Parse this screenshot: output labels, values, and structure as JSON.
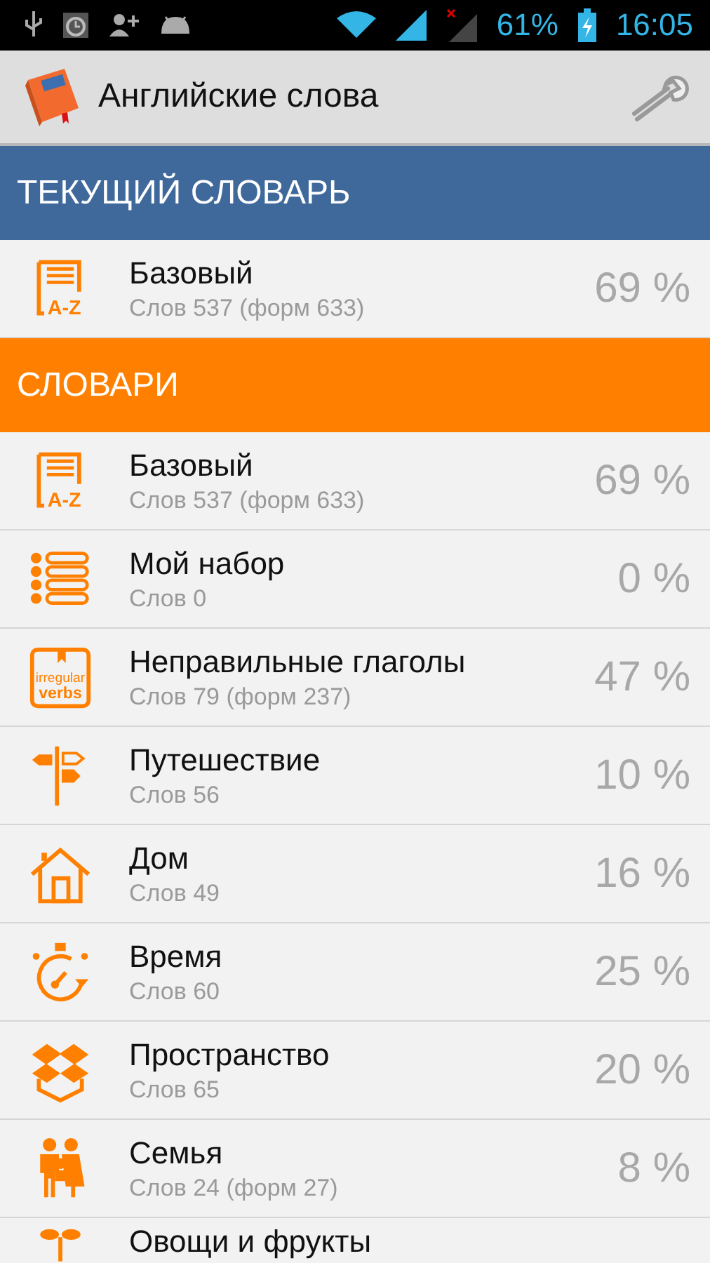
{
  "status_bar": {
    "battery": "61%",
    "time": "16:05"
  },
  "app_bar": {
    "title": "Английские слова"
  },
  "current_section": {
    "title": "ТЕКУЩИЙ СЛОВАРЬ",
    "items": [
      {
        "kind": "az",
        "icon_text": "A-Z",
        "title": "Базовый",
        "subtitle": "Слов 537 (форм 633)",
        "percent": "69 %"
      }
    ]
  },
  "dictionaries_section": {
    "title": "СЛОВАРИ",
    "items": [
      {
        "kind": "az",
        "icon_text": "A-Z",
        "title": "Базовый",
        "subtitle": "Слов 537 (форм 633)",
        "percent": "69 %"
      },
      {
        "kind": "list",
        "title": "Мой набор",
        "subtitle": "Слов 0",
        "percent": "0 %"
      },
      {
        "kind": "verbs",
        "icon_text": "irregular verbs",
        "title": "Неправильные глаголы",
        "subtitle": "Слов 79 (форм 237)",
        "percent": "47 %"
      },
      {
        "kind": "signpost",
        "title": "Путешествие",
        "subtitle": "Слов 56",
        "percent": "10 %"
      },
      {
        "kind": "house",
        "title": "Дом",
        "subtitle": "Слов 49",
        "percent": "16 %"
      },
      {
        "kind": "stopwatch",
        "title": "Время",
        "subtitle": "Слов 60",
        "percent": "25 %"
      },
      {
        "kind": "box",
        "title": "Пространство",
        "subtitle": "Слов 65",
        "percent": "20 %"
      },
      {
        "kind": "family",
        "title": "Семья",
        "subtitle": "Слов 24 (форм 27)",
        "percent": "8 %"
      },
      {
        "kind": "sprout",
        "title": "Овощи и фрукты"
      }
    ]
  }
}
